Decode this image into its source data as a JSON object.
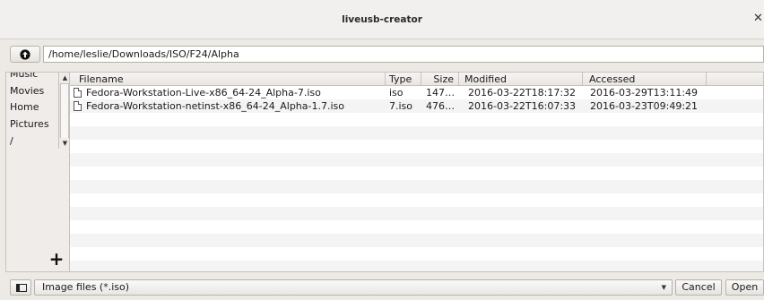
{
  "window": {
    "title": "liveusb-creator",
    "close_glyph": "✕"
  },
  "location": {
    "path": "/home/leslie/Downloads/ISO/F24/Alpha",
    "up_icon": "up-arrow-icon"
  },
  "places": {
    "items": [
      {
        "label": "Music"
      },
      {
        "label": "Movies"
      },
      {
        "label": "Home"
      },
      {
        "label": "Pictures"
      },
      {
        "label": "/"
      }
    ],
    "add_glyph": "+"
  },
  "files": {
    "columns": [
      "Filename",
      "Type",
      "Size",
      "Modified",
      "Accessed"
    ],
    "rows": [
      {
        "name": "Fedora-Workstation-Live-x86_64-24_Alpha-7.iso",
        "type": "iso",
        "size": "147…",
        "modified": "2016-03-22T18:17:32",
        "accessed": "2016-03-29T13:11:49"
      },
      {
        "name": "Fedora-Workstation-netinst-x86_64-24_Alpha-1.7.iso",
        "type": "7.iso",
        "size": "476…",
        "modified": "2016-03-22T16:07:33",
        "accessed": "2016-03-23T09:49:21"
      }
    ]
  },
  "bottom": {
    "filter": "Image files (*.iso)",
    "cancel_label": "Cancel",
    "open_label": "Open"
  }
}
